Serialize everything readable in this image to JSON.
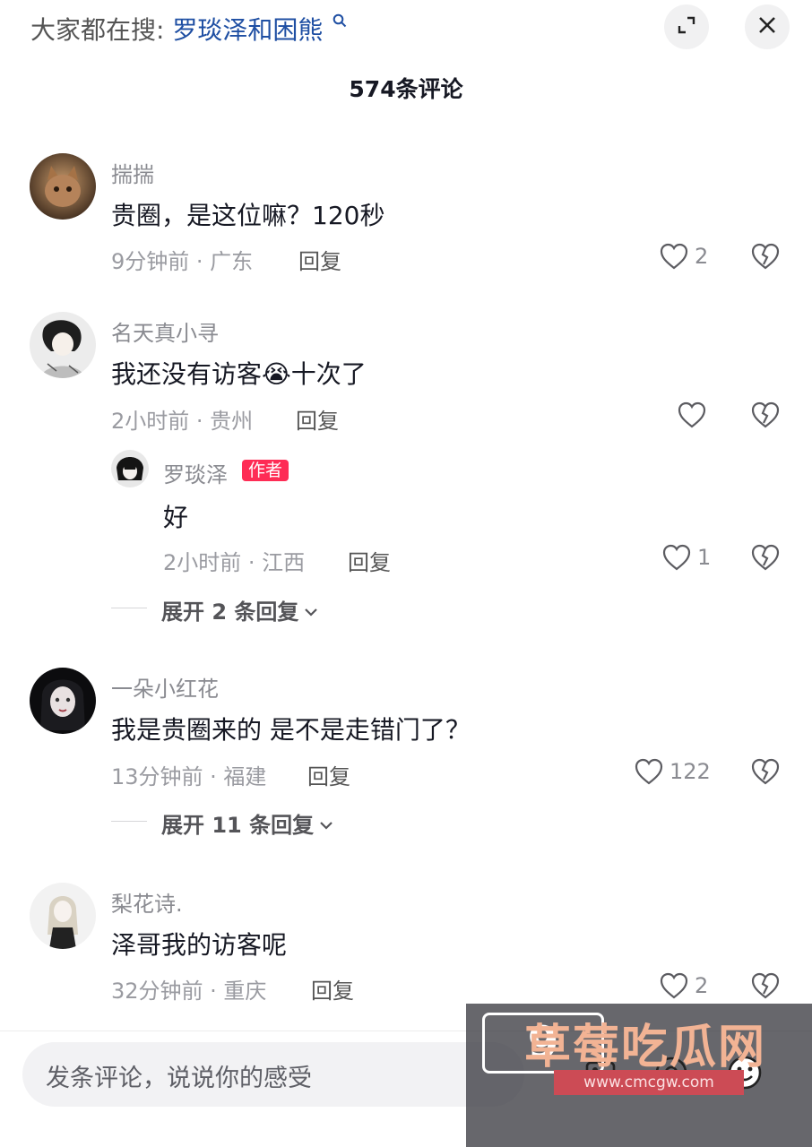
{
  "header": {
    "search_prefix": "大家都在搜:",
    "search_query": "罗琰泽和困熊",
    "count_title": "574条评论"
  },
  "comments": [
    {
      "user": "揣揣",
      "text": "贵圈，是这位嘛？120秒",
      "time": "9分钟前 · 广东",
      "reply_label": "回复",
      "likes": "2"
    },
    {
      "user": "名天真小寻",
      "text_before": "我还没有访客",
      "emoji": "😭",
      "text_after": "十次了",
      "time": "2小时前 · 贵州",
      "reply_label": "回复",
      "likes": "",
      "sub_reply": {
        "user": "罗琰泽",
        "badge": "作者",
        "text": "好",
        "time": "2小时前 · 江西",
        "reply_label": "回复",
        "likes": "1"
      },
      "expand_label": "展开 2 条回复"
    },
    {
      "user": "一朵小红花",
      "text": "我是贵圈来的 是不是走错门了？",
      "time": "13分钟前 · 福建",
      "reply_label": "回复",
      "likes": "122",
      "expand_label": "展开 11 条回复"
    },
    {
      "user": "梨花诗.",
      "text": "泽哥我的访客呢",
      "time": "32分钟前 · 重庆",
      "reply_label": "回复",
      "likes": "2"
    }
  ],
  "input": {
    "placeholder": "发条评论，说说你的感受"
  },
  "watermark": {
    "logo": "9",
    "text": "草莓吃瓜网",
    "url": "www.cmcgw.com"
  },
  "icons": {
    "expand": "expand-icon",
    "close": "close-icon",
    "search": "search-icon",
    "like": "heart-icon",
    "dislike": "broken-heart-icon",
    "chevron": "chevron-down-icon"
  }
}
